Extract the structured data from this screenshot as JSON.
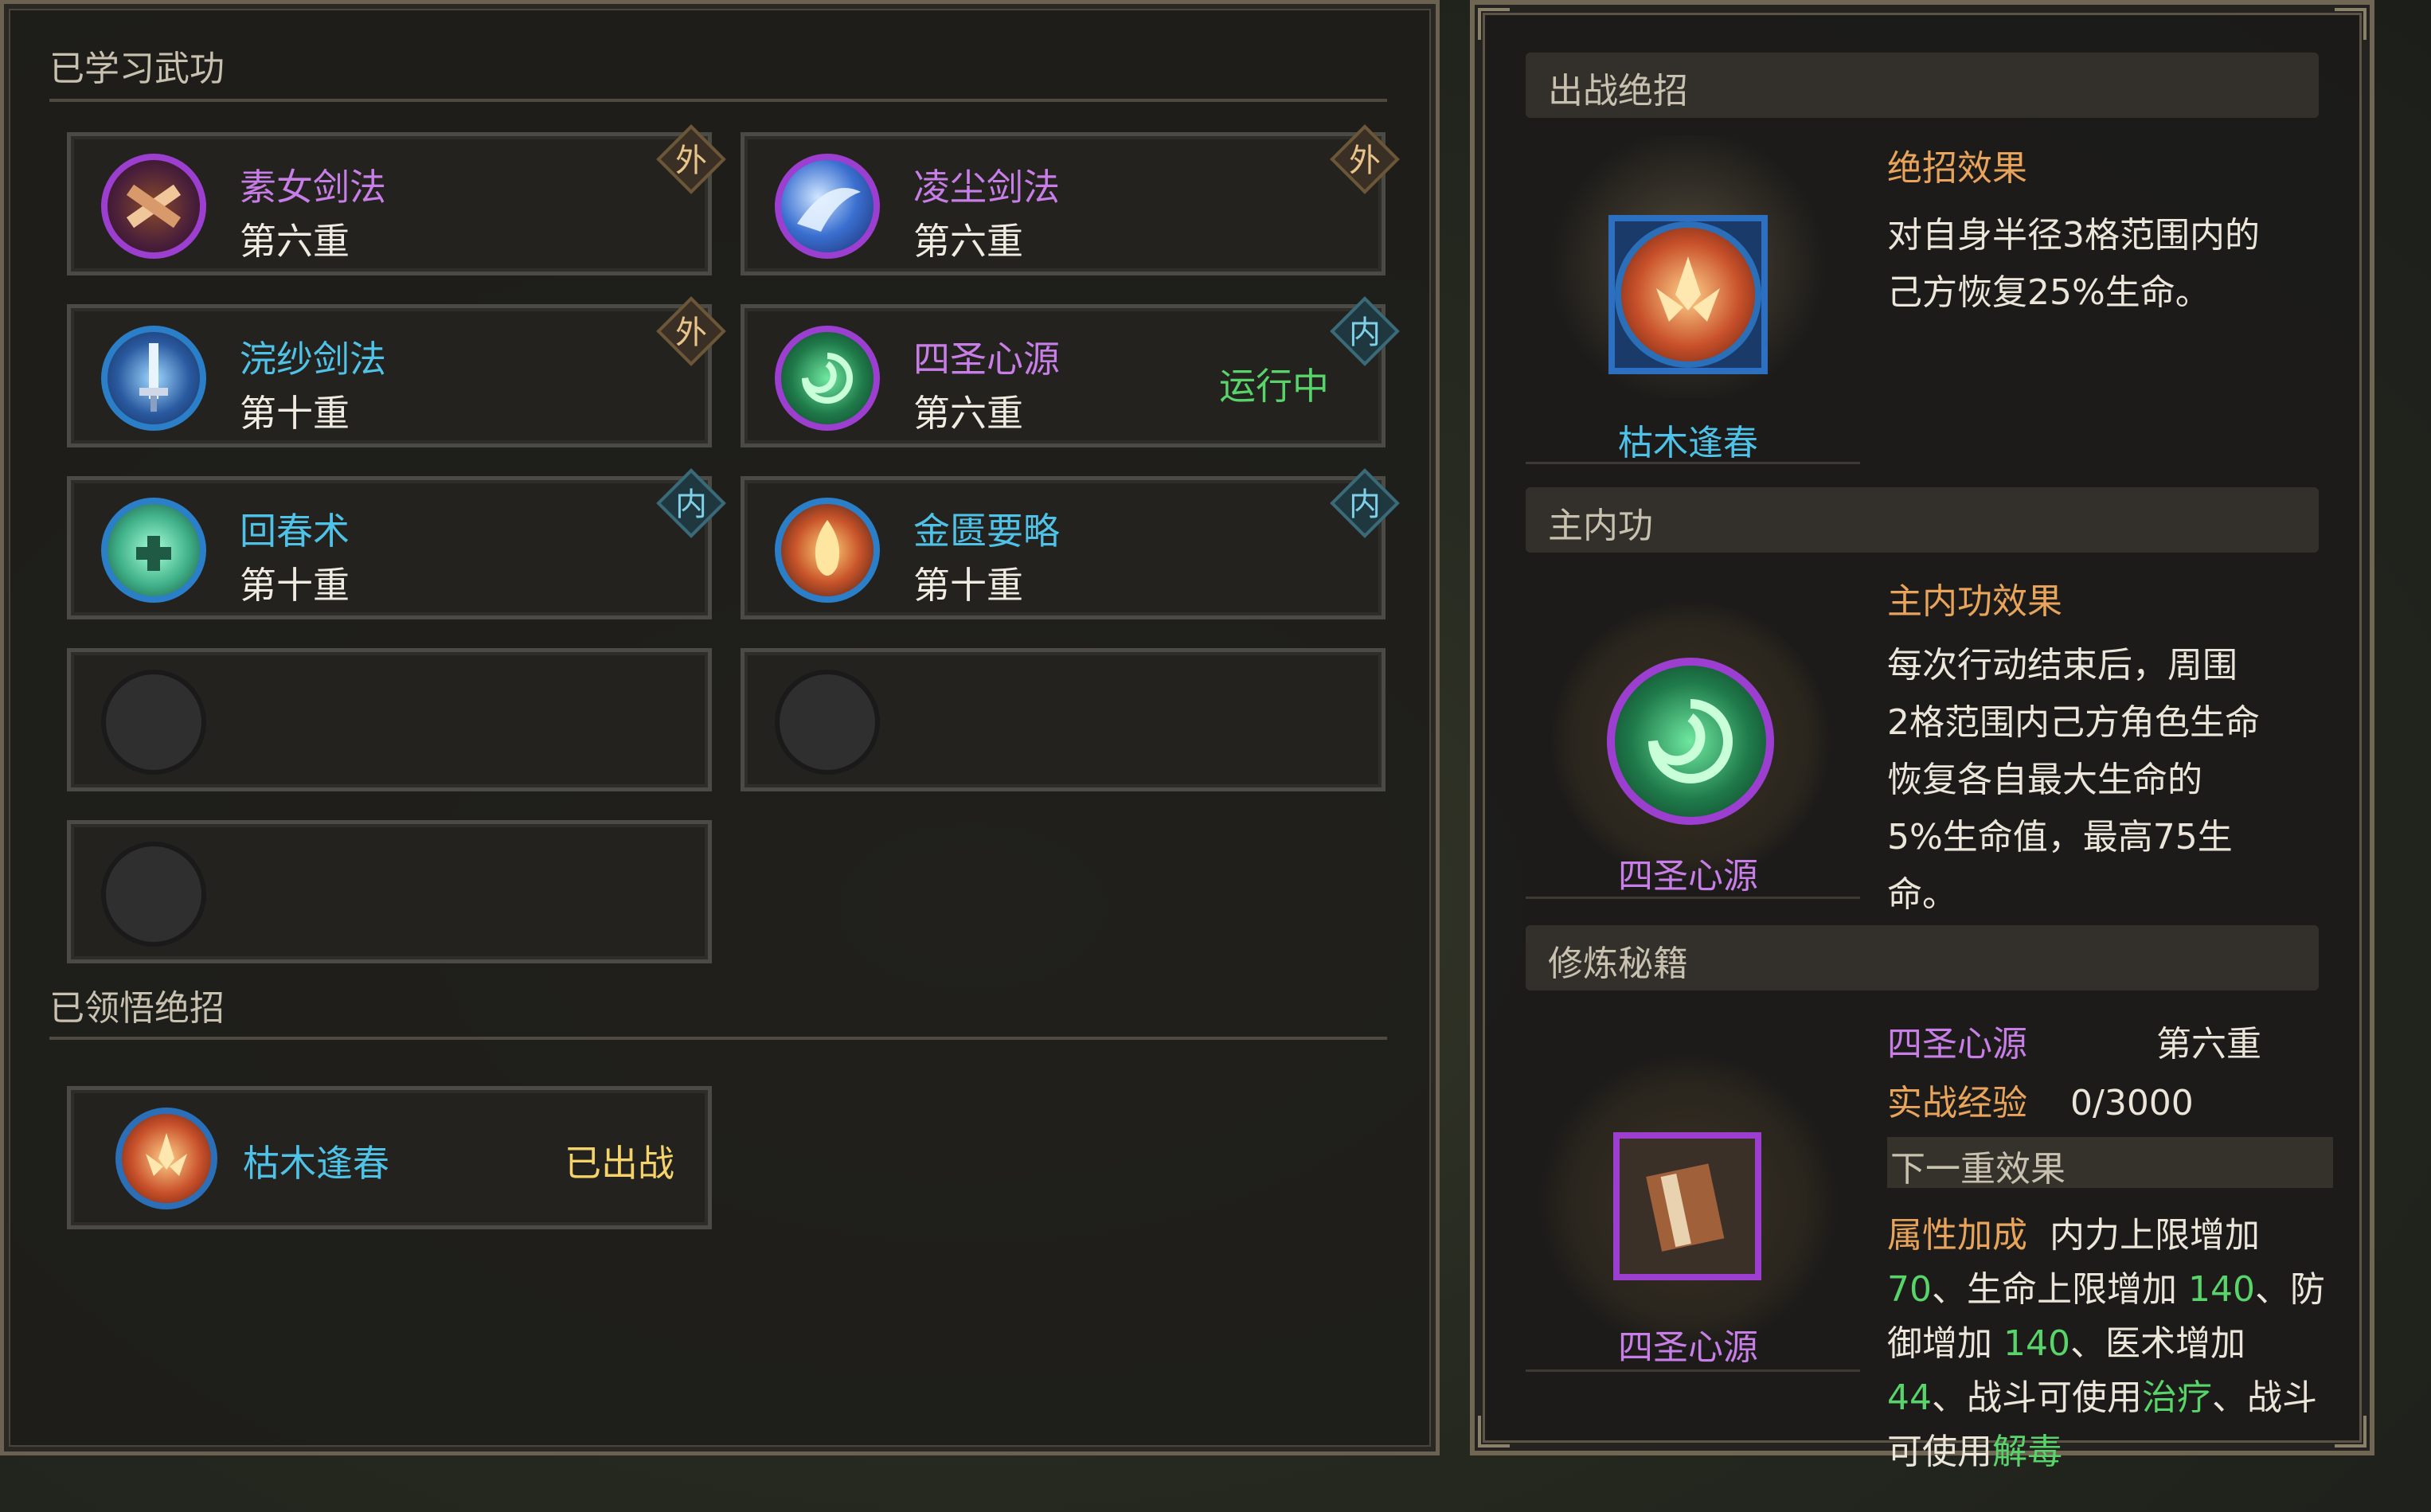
{
  "left": {
    "learned_title": "已学习武功",
    "skills": [
      {
        "name": "素女剑法",
        "level": "第六重",
        "type": "外",
        "name_color": "#c77ee6"
      },
      {
        "name": "凌尘剑法",
        "level": "第六重",
        "type": "外",
        "name_color": "#c77ee6"
      },
      {
        "name": "浣纱剑法",
        "level": "第十重",
        "type": "外",
        "name_color": "#4fc2e8"
      },
      {
        "name": "四圣心源",
        "level": "第六重",
        "type": "内",
        "status": "运行中",
        "name_color": "#c77ee6"
      },
      {
        "name": "回春术",
        "level": "第十重",
        "type": "内",
        "name_color": "#4fc2e8"
      },
      {
        "name": "金匮要略",
        "level": "第十重",
        "type": "内",
        "name_color": "#4fc2e8"
      }
    ],
    "ultimate_title": "已领悟绝招",
    "ultimate": {
      "name": "枯木逢春",
      "status": "已出战"
    }
  },
  "right": {
    "battle_ultimate": {
      "header": "出战绝招",
      "name": "枯木逢春",
      "effect_title": "绝招效果",
      "effect_line1": "对自身半径3格范围内的",
      "effect_line2": "己方恢复25%生命。"
    },
    "main_internal": {
      "header": "主内功",
      "name": "四圣心源",
      "effect_title": "主内功效果",
      "lines": [
        "每次行动结束后，周围",
        "2格范围内己方角色生命",
        "恢复各自最大生命的",
        "5%生命值，最高75生",
        "命。"
      ]
    },
    "training": {
      "header": "修炼秘籍",
      "book_name": "四圣心源",
      "name": "四圣心源",
      "level": "第六重",
      "exp_label": "实战经验",
      "exp_value": "0/3000",
      "next_title": "下一重效果",
      "attr_label": "属性加成",
      "line1_text": "内力上限增加",
      "v70": "70",
      "line2_text": "、生命上限增加",
      "v140a": "140",
      "line2_tail": "、防",
      "line3_text": "御增加",
      "v140b": "140",
      "line3_mid": "、医术增加",
      "v44": "44",
      "line4_mid": "、战斗可使用",
      "heal": "治疗",
      "line4_tail": "、战斗",
      "line5_text": "可使用",
      "detox": "解毒"
    }
  },
  "colors": {
    "purple": "#c77ee6",
    "cyan": "#4fc2e8",
    "green": "#58d46a",
    "orange": "#e8a45a",
    "gold": "#f3d36a"
  }
}
